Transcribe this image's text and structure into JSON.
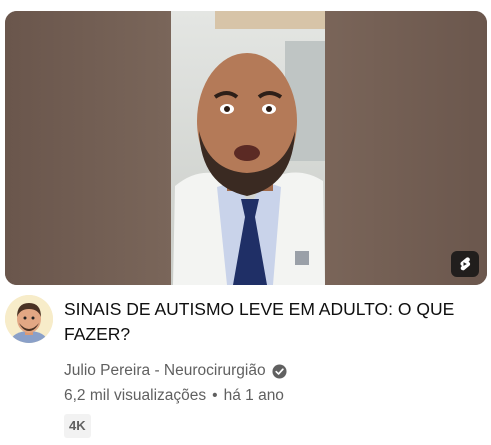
{
  "video": {
    "title": "SINAIS DE AUTISMO LEVE EM ADULTO: O QUE FAZER?",
    "channel": "Julio Pereira - Neurocirurgião",
    "views": "6,2 mil visualizações",
    "separator": "•",
    "age": "há 1 ano",
    "quality_badge": "4K"
  },
  "icons": {
    "thumbnail_badge": "shorts-icon",
    "verified": "verified-check-icon",
    "avatar": "channel-avatar-cartoon"
  },
  "colors": {
    "title": "#0f0f0f",
    "meta": "#606060",
    "badge_bg": "#f2f2f2",
    "thumbnail_frame": "#6e5a4f"
  }
}
